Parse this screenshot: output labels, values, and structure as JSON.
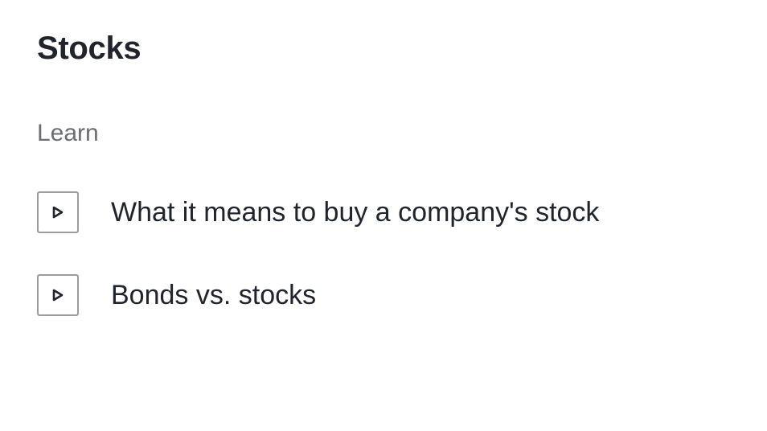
{
  "header": {
    "title": "Stocks"
  },
  "section": {
    "heading": "Learn"
  },
  "lessons": [
    {
      "label": "What it means to buy a company's stock",
      "icon": "play-icon"
    },
    {
      "label": "Bonds vs. stocks",
      "icon": "play-icon"
    }
  ],
  "colors": {
    "text": "#21242c",
    "muted": "#6b6d72",
    "icon_border": "#9a9ca0"
  }
}
